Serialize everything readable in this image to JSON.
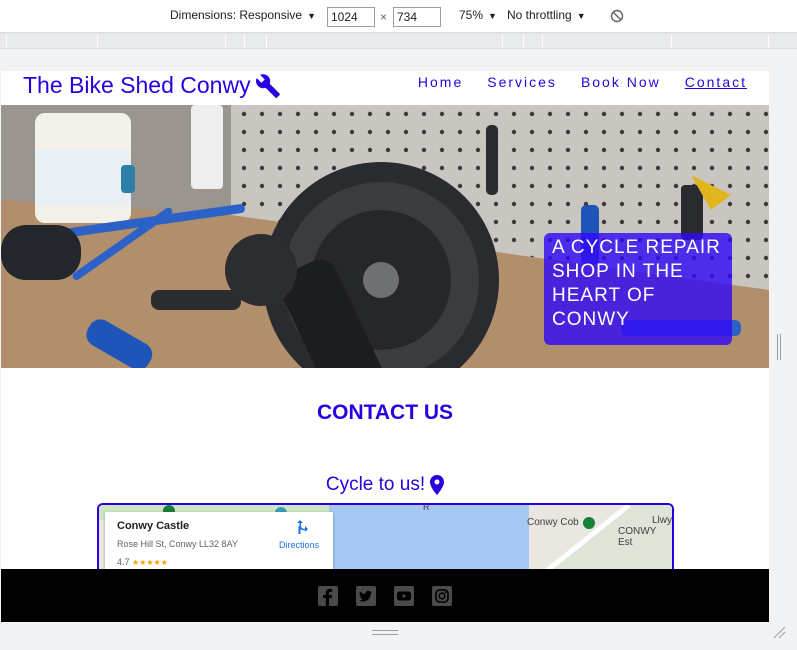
{
  "devtools": {
    "dimensions_label": "Dimensions: Responsive",
    "width_value": "1024",
    "times": "×",
    "height_value": "734",
    "zoom": "75%",
    "throttling": "No throttling"
  },
  "site": {
    "brand": "The Bike Shed Conwy",
    "nav": [
      "Home",
      "Services",
      "Book Now",
      "Contact"
    ],
    "active_nav": "Contact",
    "hero_cta": "A CYCLE REPAIR SHOP IN THE HEART OF CONWY",
    "contact_title": "CONTACT US",
    "cycle_text": "Cycle to us!",
    "map": {
      "place_name": "Conwy Castle",
      "address": "Rose Hill St, Conwy LL32 8AY",
      "rating": "4.7",
      "stars": "★★★★★",
      "directions": "Directions",
      "label_cob": "Conwy Cob",
      "label_llwy": "Llwy",
      "label_est": "CONWY Est",
      "label_r": "R"
    },
    "colors": {
      "brand": "#2b00e0",
      "cta_bg": "#320af5",
      "footer_bg": "#000000"
    },
    "social_icons": [
      "facebook-icon",
      "twitter-icon",
      "youtube-icon",
      "instagram-icon"
    ]
  }
}
